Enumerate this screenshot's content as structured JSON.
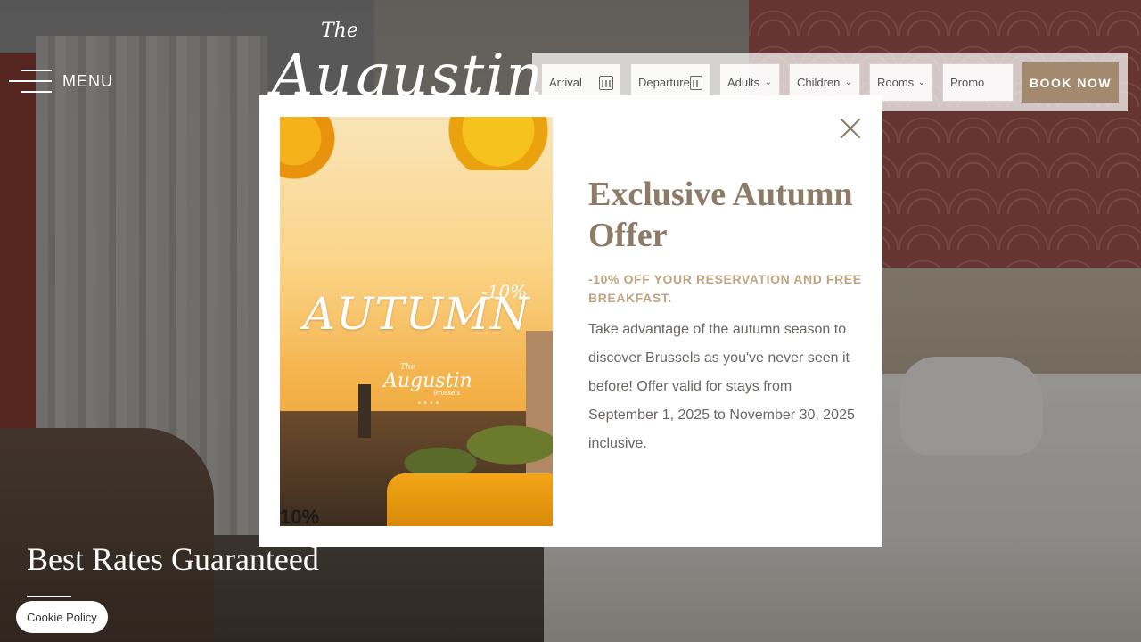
{
  "header": {
    "menu_label": "MENU",
    "logo_the": "The",
    "logo_name": "Augustin"
  },
  "booking": {
    "arrival_placeholder": "Arrival",
    "departure_placeholder": "Departure",
    "adults_label": "Adults",
    "children_label": "Children",
    "rooms_label": "Rooms",
    "promo_placeholder": "Promo",
    "book_now_label": "BOOK NOW"
  },
  "hero": {
    "tagline": "Best Rates Guaranteed"
  },
  "cookie": {
    "label": "Cookie Policy"
  },
  "modal": {
    "image": {
      "title": "AUTUMN",
      "discount": "-10%",
      "logo_the": "The",
      "logo_name": "Augustin",
      "logo_city": "Brussels",
      "logo_stars": "••••",
      "bottom_text": "10%"
    },
    "title": "Exclusive Autumn Offer",
    "subtitle": "-10% OFF YOUR RESERVATION AND FREE BREAKFAST.",
    "body": "Take advantage of the autumn season to discover Brussels as you've never seen it before! Offer valid for stays from September 1, 2025 to November 30, 2025 inclusive."
  },
  "colors": {
    "accent": "#8d7b66",
    "subtitle": "#c1a47f",
    "book_button": "#a3896d"
  }
}
